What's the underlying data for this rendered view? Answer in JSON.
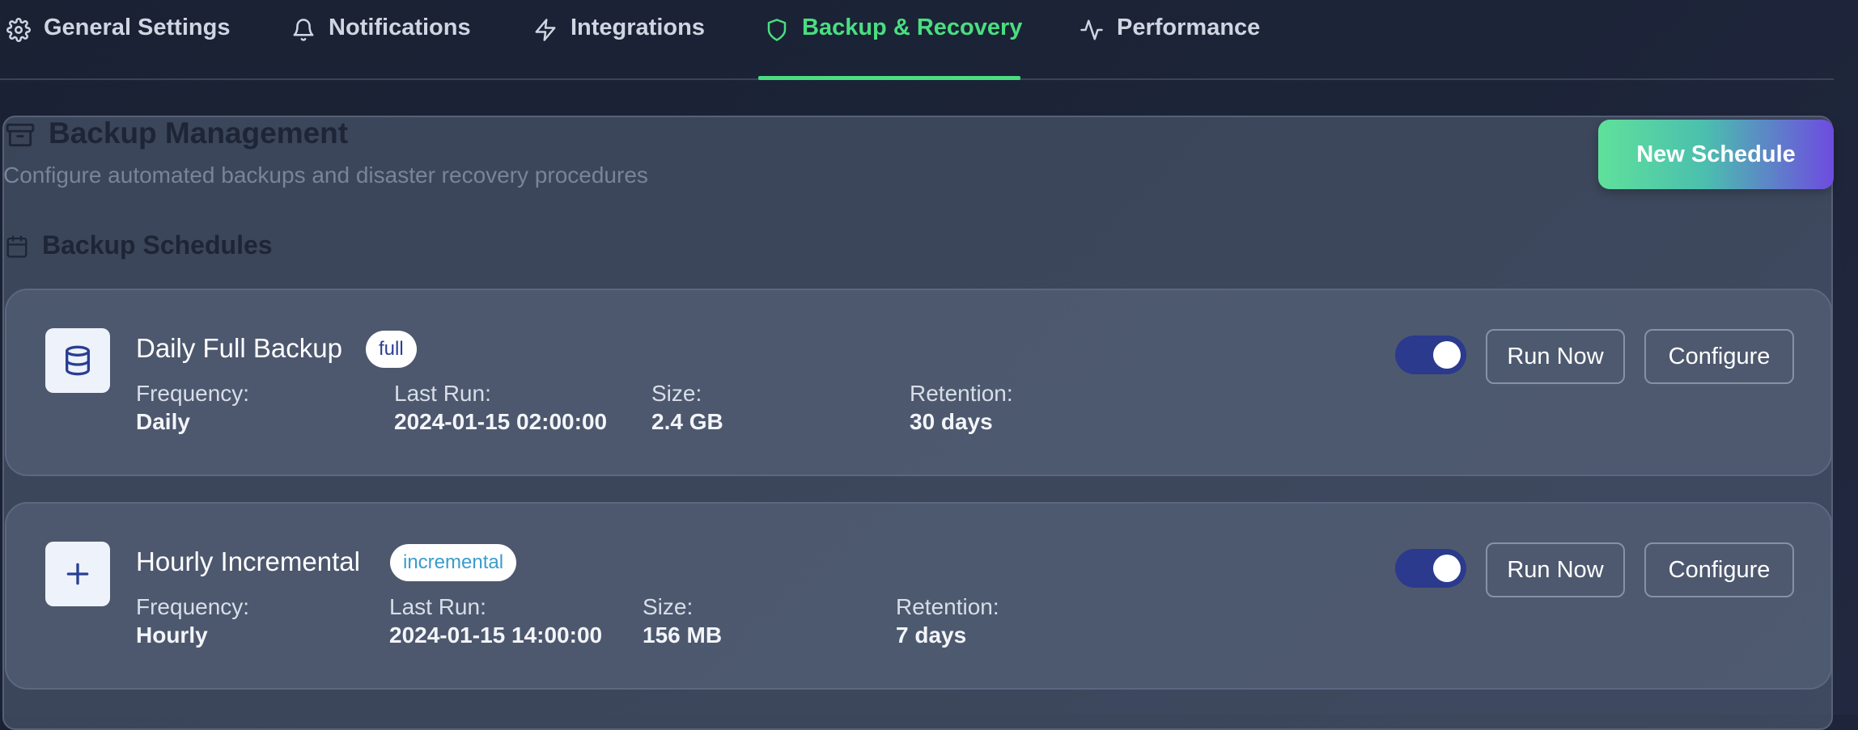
{
  "tabs": [
    {
      "label": "General Settings",
      "icon": "gear-icon",
      "active": false
    },
    {
      "label": "Notifications",
      "icon": "bell-icon",
      "active": false
    },
    {
      "label": "Integrations",
      "icon": "lightning-icon",
      "active": false
    },
    {
      "label": "Backup & Recovery",
      "icon": "shield-icon",
      "active": true
    },
    {
      "label": "Performance",
      "icon": "activity-icon",
      "active": false
    }
  ],
  "page": {
    "icon": "archive-icon",
    "title": "Backup Management",
    "subtitle": "Configure automated backups and disaster recovery procedures",
    "new_schedule_label": "New Schedule"
  },
  "section": {
    "icon": "calendar-icon",
    "title": "Backup Schedules"
  },
  "field_labels": {
    "frequency": "Frequency:",
    "last_run": "Last Run:",
    "size": "Size:",
    "retention": "Retention:"
  },
  "schedules": [
    {
      "icon": "database-icon",
      "name": "Daily Full Backup",
      "type": "full",
      "frequency": "Daily",
      "last_run": "2024-01-15 02:00:00",
      "size": "2.4 GB",
      "retention": "30 days",
      "enabled": true,
      "run_label": "Run Now",
      "configure_label": "Configure"
    },
    {
      "icon": "plus-icon",
      "name": "Hourly Incremental",
      "type": "incremental",
      "frequency": "Hourly",
      "last_run": "2024-01-15 14:00:00",
      "size": "156 MB",
      "retention": "7 days",
      "enabled": true,
      "run_label": "Run Now",
      "configure_label": "Configure"
    }
  ],
  "colors": {
    "accent": "#4ade80",
    "toggle_on": "#2b3a8c",
    "badge_full_text": "#2a3f92",
    "badge_incremental_text": "#3a9ccb"
  }
}
